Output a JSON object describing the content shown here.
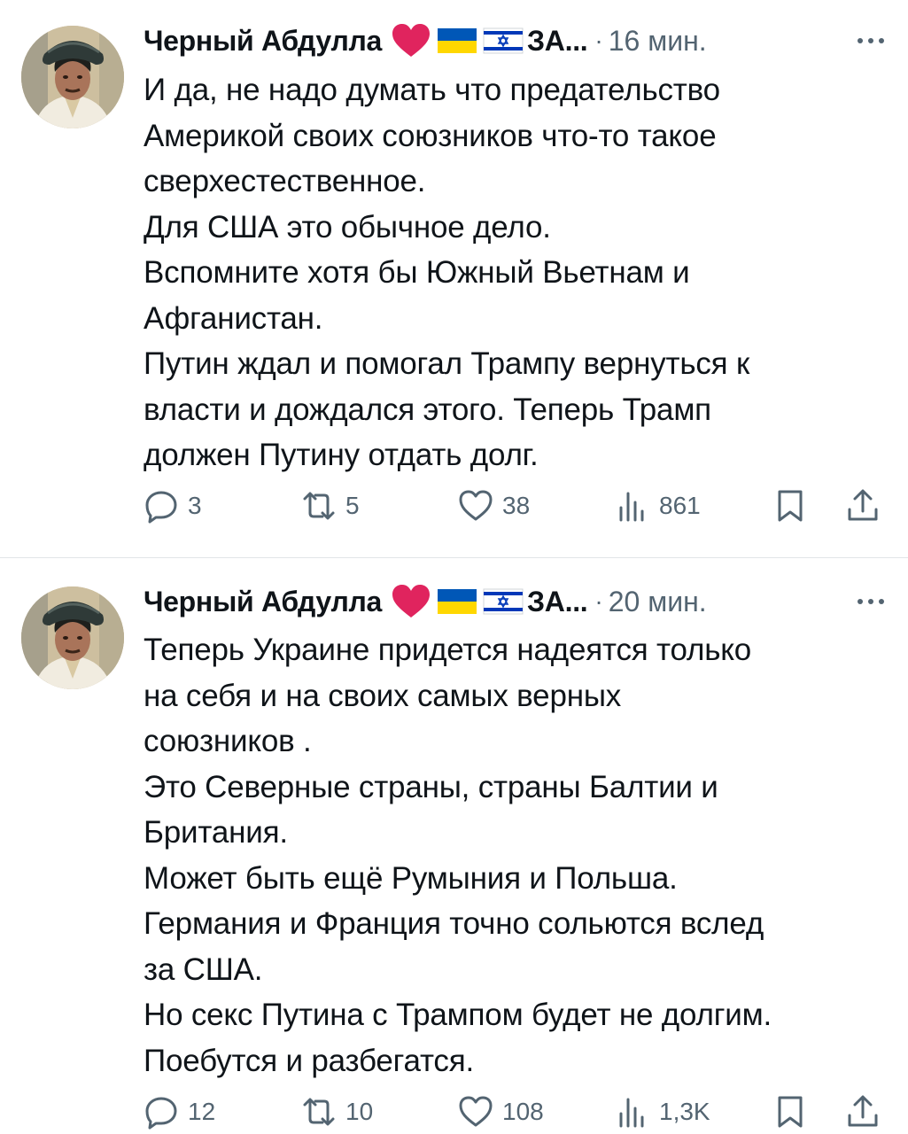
{
  "tweets": [
    {
      "author": "Черный Абдулла",
      "name_suffix": "ЗА...",
      "separator": "·",
      "time": "16 мин.",
      "lines": [
        "И да, не надо думать  что предательство",
        "Америкой своих союзников что-то такое",
        "сверхестественное.",
        "Для США это обычное дело.",
        "Вспомните хотя бы Южный Вьетнам и",
        "Афганистан.",
        "Путин ждал и помогал Трампу вернуться к",
        "власти и дождался этого. Теперь Трамп",
        "должен Путину отдать долг."
      ],
      "replies": "3",
      "reposts": "5",
      "likes": "38",
      "views": "861"
    },
    {
      "author": "Черный Абдулла",
      "name_suffix": "ЗА...",
      "separator": "·",
      "time": "20 мин.",
      "lines": [
        "Теперь Украине  придется  надеятся только",
        "на себя и на своих самых верных",
        "союзников .",
        "Это Северные страны, страны Балтии и",
        "Британия.",
        "Может быть ещё Румыния и Польша.",
        "Германия и Франция точно сольются вслед",
        "за США.",
        "Но секс Путина с Трампом будет не долгим.",
        "Поебутся и разбегатся."
      ],
      "replies": "12",
      "reposts": "10",
      "likes": "108",
      "views": "1,3K"
    }
  ],
  "icons": {
    "heart": "red-heart-emoji",
    "flag_1": "ukraine-flag-emoji",
    "flag_2": "israel-flag-emoji",
    "reply": "reply-icon",
    "repost": "repost-icon",
    "like": "like-icon",
    "views": "views-icon",
    "bookmark": "bookmark-icon",
    "share": "share-icon",
    "more": "more-icon"
  },
  "colors": {
    "text": "#0f1419",
    "secondary": "#536471",
    "heart": "#e0245e",
    "ukraine_blue": "#0057b7",
    "ukraine_yellow": "#ffd700",
    "israel_blue": "#0038b8"
  }
}
